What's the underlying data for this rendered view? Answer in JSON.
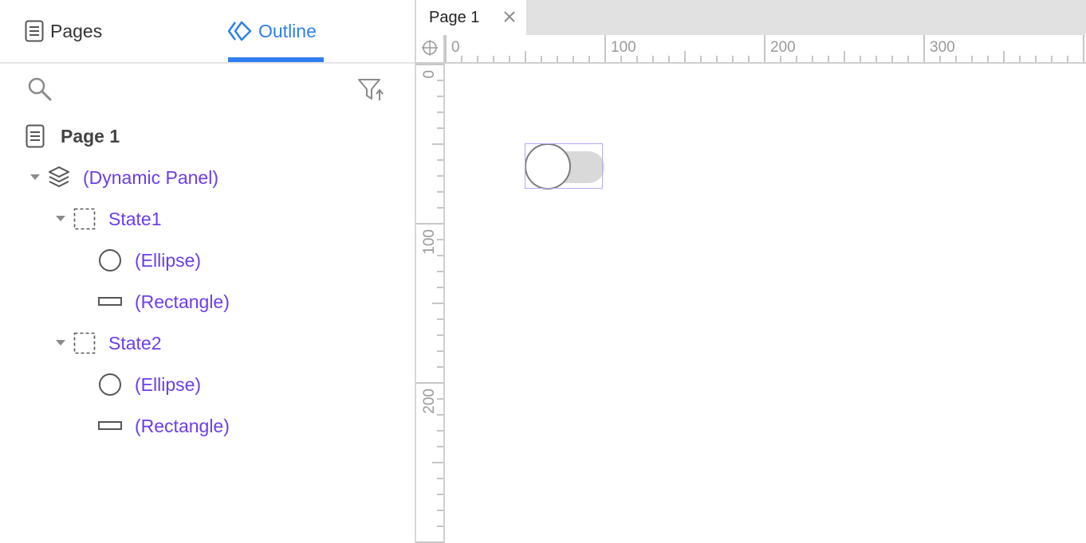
{
  "left_panel": {
    "tabs": {
      "pages_label": "Pages",
      "outline_label": "Outline",
      "active": "Outline"
    },
    "toolbar": {
      "search_icon": "search-icon",
      "filter_icon": "filter-sort-icon"
    },
    "tree": {
      "page": {
        "label": "Page 1",
        "icon": "page-icon"
      },
      "dynamic_panel": {
        "label": "(Dynamic Panel)",
        "icon": "layers-icon",
        "expanded": true
      },
      "states": [
        {
          "label": "State1",
          "icon": "state-icon",
          "expanded": true,
          "children": [
            {
              "label": "(Ellipse)",
              "icon": "ellipse-icon"
            },
            {
              "label": "(Rectangle)",
              "icon": "rectangle-icon"
            }
          ]
        },
        {
          "label": "State2",
          "icon": "state-icon",
          "expanded": true,
          "children": [
            {
              "label": "(Ellipse)",
              "icon": "ellipse-icon"
            },
            {
              "label": "(Rectangle)",
              "icon": "rectangle-icon"
            }
          ]
        }
      ]
    }
  },
  "editor": {
    "tab": {
      "label": "Page 1",
      "close_icon": "close-icon"
    },
    "rulers": {
      "horizontal_labels": [
        "0",
        "100",
        "200",
        "300"
      ],
      "vertical_labels": [
        "0",
        "100",
        "200"
      ]
    }
  },
  "colors": {
    "accent": "#2f7ff0",
    "outline_item": "#6b3df0",
    "selection": "#b9a6f5",
    "toggle_track": "#d9d9d9"
  }
}
